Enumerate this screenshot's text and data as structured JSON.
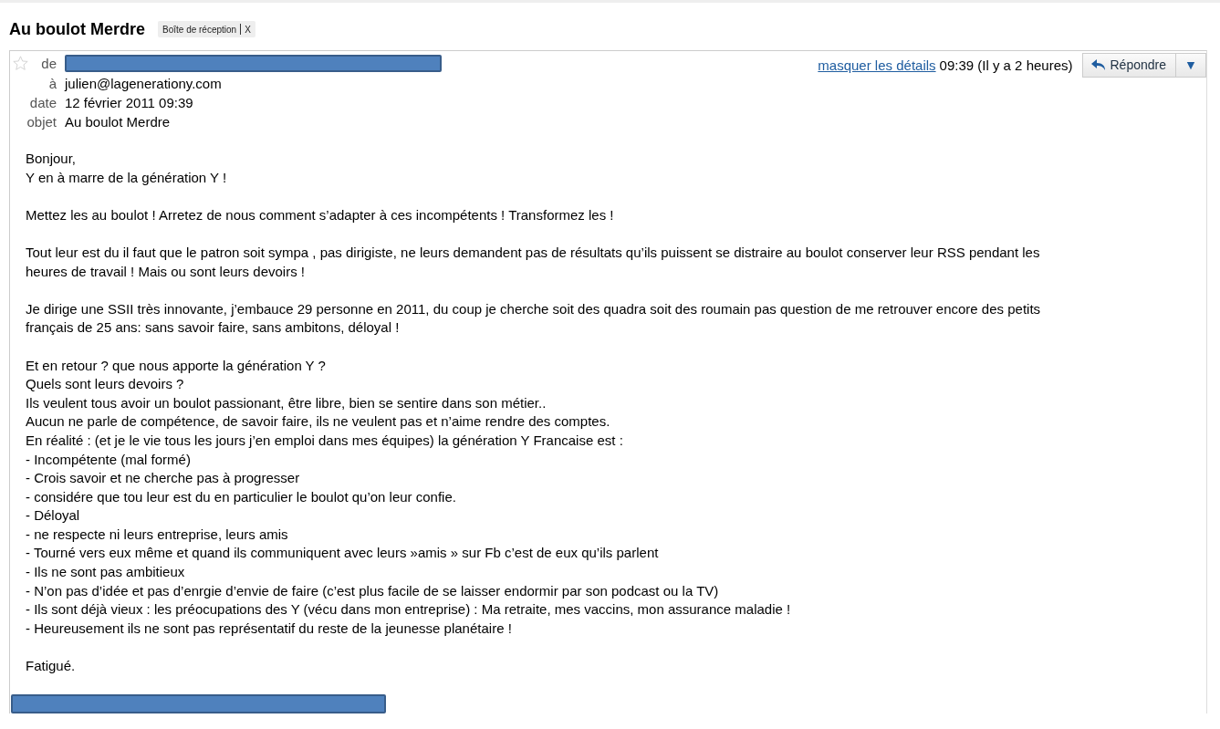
{
  "subject": "Au boulot Merdre",
  "labels": [
    {
      "text": "Boîte de réception",
      "removable_mark": "X"
    }
  ],
  "header": {
    "starred": false,
    "fields": [
      {
        "kind": "redacted",
        "label": "de"
      },
      {
        "kind": "text",
        "label": "à",
        "value": "julien@lagenerationy.com"
      },
      {
        "kind": "text",
        "label": "date",
        "value": "12 février 2011 09:39"
      },
      {
        "kind": "text",
        "label": "objet",
        "value": "Au boulot Merdre"
      }
    ],
    "details_link": "masquer les détails",
    "time": "09:39 (Il y a 2 heures)",
    "reply_button": "Répondre",
    "more_button": "▼"
  },
  "body": [
    [
      "Bonjour,",
      "Y en à marre de la génération Y !"
    ],
    [
      "Mettez les au boulot ! Arretez de nous comment s’adapter à ces incompétents ! Transformez les !"
    ],
    [
      "Tout leur est du il faut que le patron soit sympa , pas dirigiste, ne leurs demandent pas de résultats qu’ils puissent se distraire au boulot conserver leur RSS pendant les",
      "heures de travail ! Mais ou sont leurs devoirs !"
    ],
    [
      "Je dirige une SSII très innovante, j’embauce 29 personne en 2011, du coup je cherche soit des quadra soit des roumain pas question de me retrouver encore des petits",
      "français de 25 ans: sans savoir faire,  sans ambitons, déloyal !"
    ],
    [
      "Et en retour ? que nous apporte la génération Y ?",
      "Quels sont leurs devoirs ?",
      "Ils veulent tous avoir un boulot passionant, être libre, bien se sentire dans son métier..",
      "Aucun ne parle de compétence, de savoir faire, ils ne veulent pas et n’aime rendre des comptes.",
      "En réalité : (et je le vie tous les jours j’en emploi dans mes équipes) la génération Y Francaise est :",
      "- Incompétente (mal formé)",
      "- Crois savoir et ne cherche pas à progresser",
      "- considére que tou leur est du en particulier le boulot qu’on leur confie.",
      "- Déloyal",
      "- ne respecte ni leurs entreprise, leurs amis",
      "- Tourné vers eux même et quand ils communiquent avec leurs  »amis » sur Fb c’est de eux qu’ils parlent",
      "- Ils ne sont pas ambitieux",
      "- N’on pas d’idée et pas d’enrgie d’envie de faire (c’est plus facile de se laisser endormir par son podcast ou la TV)",
      "- Ils sont déjà vieux : les préocupations des Y (vécu dans mon entreprise) : Ma retraite, mes vaccins, mon assurance maladie !",
      "- Heureusement ils ne sont pas représentatif du reste de la jeunesse planétaire !"
    ],
    [
      "Fatigué."
    ]
  ],
  "signature": {
    "kind": "redacted"
  }
}
